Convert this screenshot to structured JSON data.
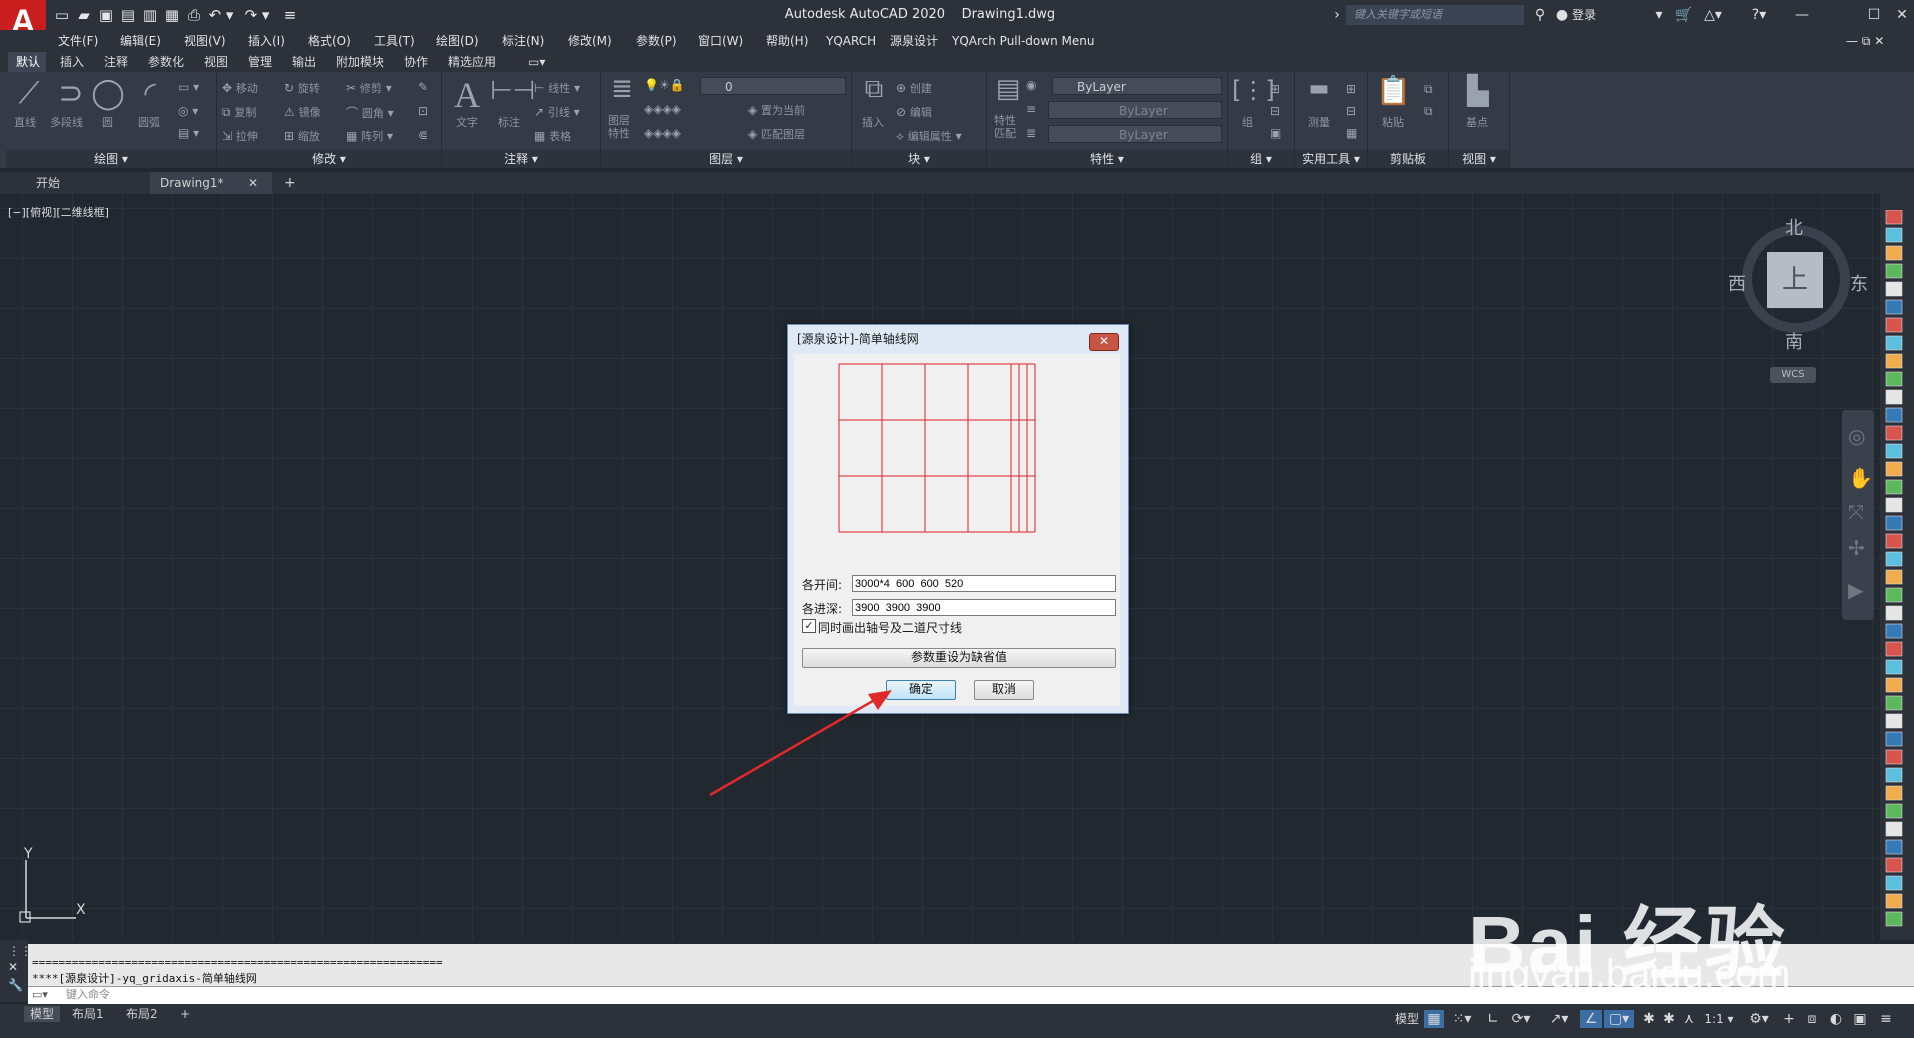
{
  "app": {
    "title": "Autodesk AutoCAD 2020",
    "document": "Drawing1.dwg",
    "logo_letter": "A",
    "search_placeholder": "键入关键字或短语",
    "login_label": "登录"
  },
  "menubar": [
    "文件(F)",
    "编辑(E)",
    "视图(V)",
    "插入(I)",
    "格式(O)",
    "工具(T)",
    "绘图(D)",
    "标注(N)",
    "修改(M)",
    "参数(P)",
    "窗口(W)",
    "帮助(H)",
    "YQARCH",
    "源泉设计",
    "YQArch Pull-down Menu"
  ],
  "ribbon_tabs": [
    "默认",
    "插入",
    "注释",
    "参数化",
    "视图",
    "管理",
    "输出",
    "附加模块",
    "协作",
    "精选应用"
  ],
  "ribbon": {
    "draw": {
      "title": "绘图",
      "line": "直线",
      "polyline": "多段线",
      "circle": "圆",
      "arc": "圆弧"
    },
    "modify": {
      "title": "修改",
      "move": "移动",
      "rotate": "旋转",
      "trim": "修剪",
      "copy": "复制",
      "mirror": "镜像",
      "fillet": "圆角",
      "stretch": "拉伸",
      "scale": "缩放",
      "array": "阵列"
    },
    "annotation": {
      "title": "注释",
      "text": "文字",
      "dimension": "标注",
      "linear": "线性",
      "leader": "引线",
      "table": "表格"
    },
    "layers": {
      "title": "图层",
      "layer_props": "图层特性",
      "current_layer": "0",
      "set_current": "置为当前",
      "match_layer": "匹配图层"
    },
    "block": {
      "title": "块",
      "insert": "插入",
      "create": "创建",
      "edit": "编辑",
      "edit_attr": "编辑属性"
    },
    "properties": {
      "title": "特性",
      "match": "特性匹配",
      "color": "ByLayer",
      "linetype": "ByLayer",
      "lineweight": "ByLayer"
    },
    "groups": {
      "title": "组",
      "group": "组"
    },
    "utilities": {
      "title": "实用工具",
      "measure": "测量"
    },
    "clipboard": {
      "title": "剪贴板",
      "paste": "粘贴"
    },
    "view": {
      "title": "视图",
      "base": "基点"
    }
  },
  "file_tabs": {
    "start": "开始",
    "drawing": "Drawing1*",
    "close": "✕",
    "add": "+"
  },
  "viewport_label": "[−][俯视][二维线框]",
  "viewcube": {
    "north": "北",
    "south": "南",
    "east": "东",
    "west": "西",
    "face": "上",
    "wcs": "WCS"
  },
  "ucs": {
    "x": "X",
    "y": "Y"
  },
  "dialog": {
    "title": "[源泉设计]-简单轴线网",
    "close": "✕",
    "bays_label": "各开间:",
    "bays_value": "3000*4  600  600  520",
    "depths_label": "各进深:",
    "depths_value": "3900  3900  3900",
    "checkbox_label": "同时画出轴号及二道尺寸线",
    "checkbox_checked": "✓",
    "reset_button": "参数重设为缺省值",
    "ok_button": "确定",
    "cancel_button": "取消",
    "grid_color": "#e0202a"
  },
  "command": {
    "history_line1": "==============================================================",
    "history_line2": "****[源泉设计]-yq_gridaxis-简单轴线网",
    "placeholder": "键入命令"
  },
  "layout_tabs": [
    "模型",
    "布局1",
    "布局2",
    "+"
  ],
  "status": {
    "model": "模型",
    "scale": "1:1"
  },
  "watermark": {
    "main": "Bai  经验",
    "sub": "jingyan.baidu.com"
  },
  "colors": {
    "accent": "#c81e1e",
    "arrow": "#e02a2a",
    "canvas": "#212830"
  }
}
